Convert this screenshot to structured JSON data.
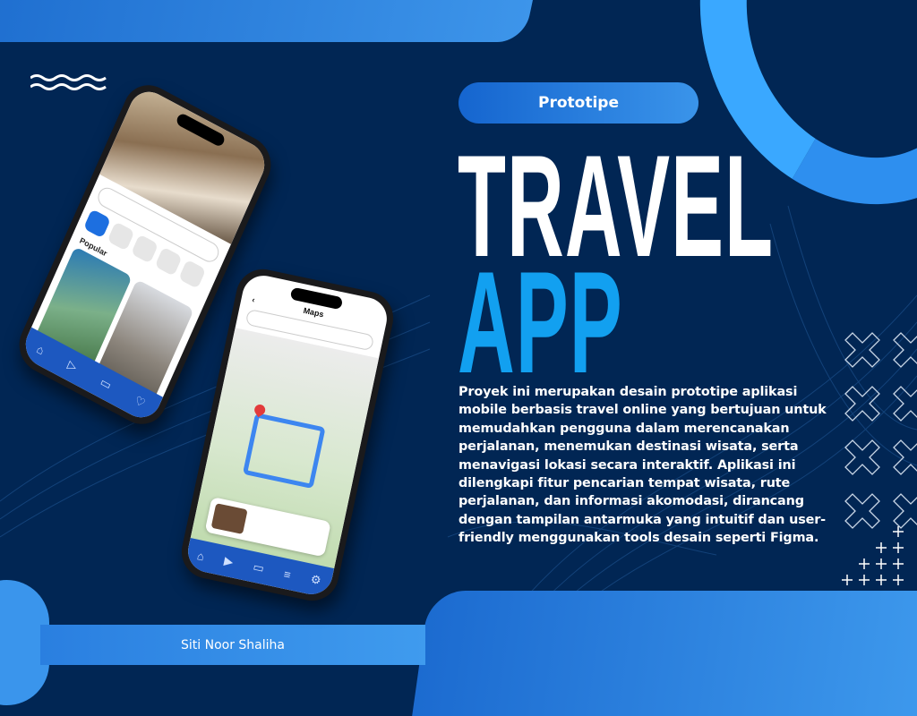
{
  "badge": "Prototipe",
  "title_line1": "TRAVEL",
  "title_line2": "APP",
  "description_lines": [
    "Proyek ini merupakan desain prototipe aplikasi",
    "mobile berbasis travel online yang bertujuan untuk",
    "memudahkan pengguna dalam merencanakan",
    "perjalanan, menemukan destinasi wisata, serta",
    "menavigasi lokasi secara interaktif. Aplikasi ini",
    "dilengkapi fitur pencarian tempat wisata, rute",
    "perjalanan, dan informasi akomodasi, dirancang",
    "dengan tampilan antarmuka yang intuitif dan user-",
    "friendly menggunakan tools desain seperti Figma."
  ],
  "author": "Siti Noor Shaliha",
  "phone1": {
    "section": "Popular"
  },
  "phone2": {
    "screen_title": "Maps",
    "back": "‹"
  },
  "colors": {
    "background": "#012654",
    "accent": "#12a0f0",
    "bar": "#3a8ee6"
  }
}
